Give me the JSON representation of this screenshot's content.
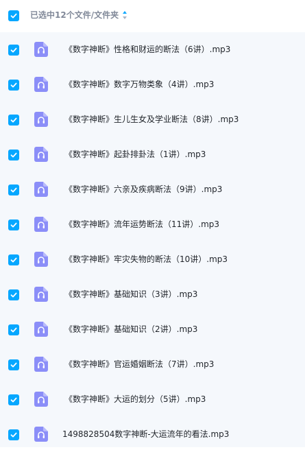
{
  "header": {
    "title": "已选中12个文件/文件夹",
    "checked": true,
    "sort_icon": "sort-icon"
  },
  "colors": {
    "accent": "#06a7ff",
    "file_icon": "#8b8ef8",
    "list_background": "#f5f8fc"
  },
  "files": [
    {
      "name": "《数字神断》性格和财运的断法（6讲）.mp3",
      "icon": "audio-file-icon",
      "checked": true
    },
    {
      "name": "《数字神断》数字万物类象（4讲）.mp3",
      "icon": "audio-file-icon",
      "checked": true
    },
    {
      "name": "《数字神断》生儿生女及学业断法（8讲）.mp3",
      "icon": "audio-file-icon",
      "checked": true
    },
    {
      "name": "《数字神断》起卦排卦法（1讲）.mp3",
      "icon": "audio-file-icon",
      "checked": true
    },
    {
      "name": "《数字神断》六亲及疾病断法（9讲）.mp3",
      "icon": "audio-file-icon",
      "checked": true
    },
    {
      "name": "《数字神断》流年运势断法（11讲）.mp3",
      "icon": "audio-file-icon",
      "checked": true
    },
    {
      "name": "《数字神断》牢灾失物的断法（10讲）.mp3",
      "icon": "audio-file-icon",
      "checked": true
    },
    {
      "name": "《数字神断》基础知识（3讲）.mp3",
      "icon": "audio-file-icon",
      "checked": true
    },
    {
      "name": "《数字神断》基础知识（2讲）.mp3",
      "icon": "audio-file-icon",
      "checked": true
    },
    {
      "name": "《数字神断》官运婚姻断法（7讲）.mp3",
      "icon": "audio-file-icon",
      "checked": true
    },
    {
      "name": "《数字神断》大运的划分（5讲）.mp3",
      "icon": "audio-file-icon",
      "checked": true
    },
    {
      "name": "1498828504数字神断-大运流年的看法.mp3",
      "icon": "audio-file-icon",
      "checked": true
    }
  ]
}
